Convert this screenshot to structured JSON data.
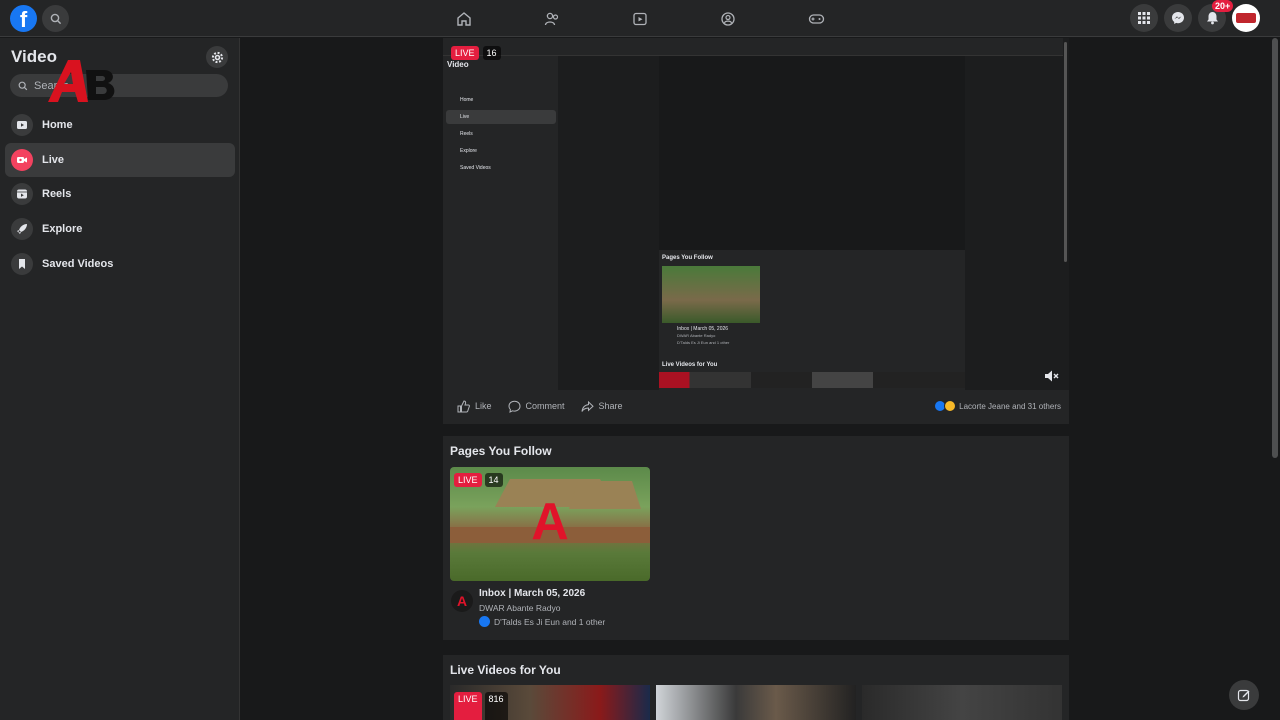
{
  "topbar": {
    "logo_letter": "f",
    "notifications_badge": "20+"
  },
  "sidebar": {
    "title": "Video",
    "search_placeholder": "Search",
    "items": [
      {
        "label": "Home",
        "icon": "video-home-icon"
      },
      {
        "label": "Live",
        "icon": "live-icon",
        "active": true
      },
      {
        "label": "Reels",
        "icon": "reels-icon"
      },
      {
        "label": "Explore",
        "icon": "explore-icon"
      },
      {
        "label": "Saved Videos",
        "icon": "bookmark-icon"
      }
    ]
  },
  "video": {
    "live_label": "LIVE",
    "viewers": "16",
    "nested": {
      "title": "Video",
      "menu": [
        "Home",
        "Live",
        "Reels",
        "Explore",
        "Saved Videos"
      ],
      "pages_title": "Pages You Follow",
      "item_title": "Inbox | March 05, 2026",
      "item_sub": "DWAR Abante Radyo",
      "item_likes": "D'Talds Es Ji Eun and 1 other",
      "live_title": "Live Videos for You"
    },
    "actions": {
      "like": "Like",
      "comment": "Comment",
      "share": "Share"
    },
    "reactions_text": "Lacorte Jeane and 31 others",
    "colors": {
      "like": "#1877f2",
      "haha": "#f7b928"
    }
  },
  "pages_follow": {
    "title": "Pages You Follow",
    "thumb_live": "LIVE",
    "thumb_viewers": "14",
    "item_title": "Inbox | March 05, 2026",
    "item_sub": "DWAR Abante Radyo",
    "item_likes": "D'Talds Es Ji Eun and 1 other"
  },
  "live_videos": {
    "title": "Live Videos for You",
    "thumb_live": "LIVE",
    "thumb_viewers": "816"
  }
}
